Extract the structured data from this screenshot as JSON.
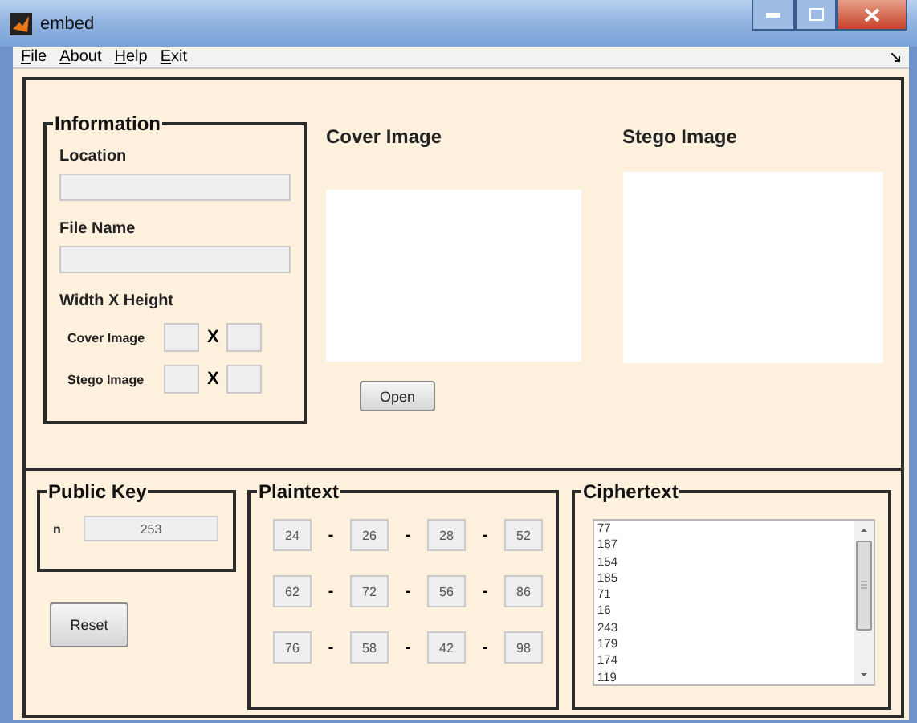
{
  "window": {
    "title": "embed"
  },
  "menu": [
    "File",
    "About",
    "Help",
    "Exit"
  ],
  "information": {
    "title": "Information",
    "location_label": "Location",
    "file_name_label": "File Name",
    "size_label": "Width X Height",
    "size_rows": [
      {
        "label": "Cover Image",
        "separator": "X"
      },
      {
        "label": "Stego Image",
        "separator": "X"
      }
    ]
  },
  "cover_image": {
    "title": "Cover Image"
  },
  "stego_image": {
    "title": "Stego Image"
  },
  "open_button": "Open",
  "public_key": {
    "title": "Public Key",
    "n_label": "n",
    "n_value": "253"
  },
  "reset_button": "Reset",
  "plaintext": {
    "title": "Plaintext",
    "rows": [
      {
        "cells": [
          "24",
          "26",
          "28",
          "52"
        ],
        "separators": [
          "-",
          "-",
          "-"
        ]
      },
      {
        "cells": [
          "62",
          "72",
          "56",
          "86"
        ],
        "separators": [
          "-",
          "-",
          "-"
        ]
      },
      {
        "cells": [
          "76",
          "58",
          "42",
          "98"
        ],
        "separators": [
          "-",
          "-",
          "-"
        ]
      }
    ]
  },
  "ciphertext": {
    "title": "Ciphertext",
    "items": [
      "77",
      "187",
      "154",
      "185",
      "71",
      "16",
      "243",
      "179",
      "174",
      "119"
    ]
  }
}
